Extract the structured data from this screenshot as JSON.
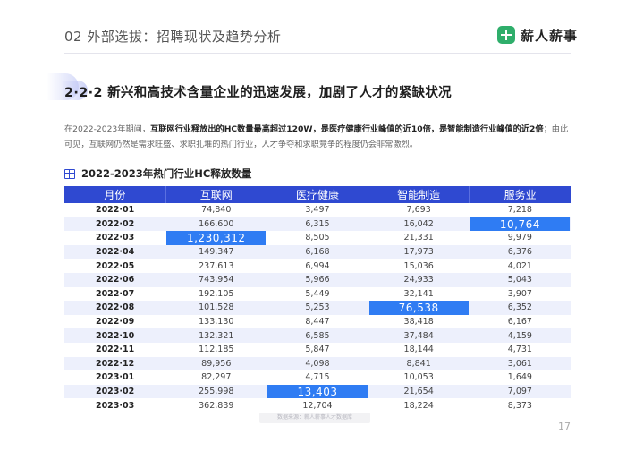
{
  "header": {
    "title": "02 外部选拔：招聘现状及趋势分析",
    "logo_text": "薪人薪事",
    "logo_icon": "hash-logo-icon"
  },
  "section": {
    "title": "2·2·2 新兴和高技术含量企业的迅速发展，加剧了人才的紧缺状况"
  },
  "description": {
    "part1": "在2022-2023年期间，",
    "bold1": "互联网行业释放出的HC数量最高超过120W，是医疗健康行业峰值的近10倍，是智能制造行业峰值的近2倍",
    "part2": "；由此可见，互联网仍然是需求旺盛、求职扎堆的热门行业，人才争夺和求职竞争的程度仍会非常激烈。"
  },
  "table": {
    "title": "2022-2023年热门行业HC释放数量",
    "headers": [
      "月份",
      "互联网",
      "医疗健康",
      "智能制造",
      "服务业"
    ],
    "rows": [
      [
        "2022·01",
        "74,840",
        "3,497",
        "7,693",
        "7,218"
      ],
      [
        "2022·02",
        "166,600",
        "6,315",
        "16,042",
        "10,764"
      ],
      [
        "2022·03",
        "1,230,312",
        "8,505",
        "21,331",
        "9,979"
      ],
      [
        "2022·04",
        "149,347",
        "6,168",
        "17,973",
        "6,376"
      ],
      [
        "2022·05",
        "237,613",
        "6,994",
        "15,036",
        "4,021"
      ],
      [
        "2022·06",
        "743,954",
        "5,966",
        "24,933",
        "5,043"
      ],
      [
        "2022·07",
        "192,105",
        "5,449",
        "32,141",
        "3,907"
      ],
      [
        "2022·08",
        "101,528",
        "5,253",
        "76,538",
        "6,352"
      ],
      [
        "2022·09",
        "133,130",
        "8,447",
        "38,418",
        "6,167"
      ],
      [
        "2022·10",
        "132,321",
        "6,585",
        "37,484",
        "4,159"
      ],
      [
        "2022·11",
        "112,185",
        "5,847",
        "18,144",
        "4,731"
      ],
      [
        "2022·12",
        "89,956",
        "4,098",
        "8,841",
        "3,061"
      ],
      [
        "2023·01",
        "82,297",
        "4,715",
        "10,053",
        "1,649"
      ],
      [
        "2023·02",
        "255,998",
        "13,403",
        "21,654",
        "7,097"
      ],
      [
        "2023·03",
        "362,839",
        "12,704",
        "18,224",
        "8,373"
      ]
    ],
    "highlights": [
      [
        1,
        4
      ],
      [
        2,
        1
      ],
      [
        7,
        3
      ],
      [
        13,
        2
      ]
    ]
  },
  "footer": {
    "source": "数据来源：薪人薪事人才数据库",
    "page": "17"
  },
  "colors": {
    "accent": "#2f49d1",
    "highlight": "#2f7cf3",
    "row_alt": "#edf0fc",
    "logo": "#2fae6b"
  }
}
